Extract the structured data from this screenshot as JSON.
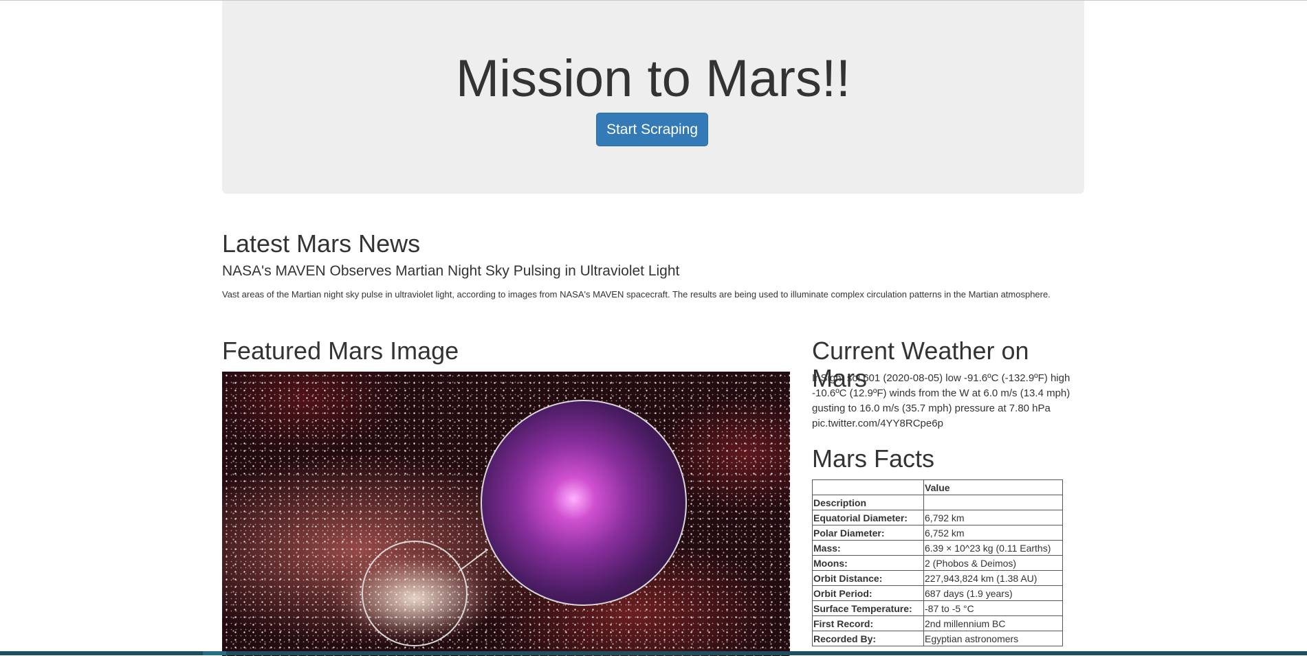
{
  "header": {
    "title": "Mission to Mars!!",
    "button_label": "Start Scraping"
  },
  "news": {
    "section_title": "Latest Mars News",
    "headline": "NASA's MAVEN Observes Martian Night Sky Pulsing in Ultraviolet Light",
    "teaser": "Vast areas of the Martian night sky pulse in ultraviolet light, according to images from NASA's MAVEN spacecraft. The results are being used to illuminate complex circulation patterns in the Martian atmosphere."
  },
  "featured_image": {
    "section_title": "Featured Mars Image"
  },
  "weather": {
    "section_title": "Current Weather on Mars",
    "text": "InSight sol 601 (2020-08-05) low -91.6ºC (-132.9ºF) high -10.6ºC (12.9ºF) winds from the W at 6.0 m/s (13.4 mph) gusting to 16.0 m/s (35.7 mph) pressure at 7.80 hPa pic.twitter.com/4YY8RCpe6p"
  },
  "facts": {
    "section_title": "Mars Facts",
    "header": [
      "",
      "Value"
    ],
    "index_label": "Description",
    "rows": [
      {
        "label": "Equatorial Diameter:",
        "value": "6,792 km"
      },
      {
        "label": "Polar Diameter:",
        "value": "6,752 km"
      },
      {
        "label": "Mass:",
        "value": "6.39 × 10^23 kg (0.11 Earths)"
      },
      {
        "label": "Moons:",
        "value": "2 (Phobos & Deimos)"
      },
      {
        "label": "Orbit Distance:",
        "value": "227,943,824 km (1.38 AU)"
      },
      {
        "label": "Orbit Period:",
        "value": "687 days (1.9 years)"
      },
      {
        "label": "Surface Temperature:",
        "value": "-87 to -5 °C"
      },
      {
        "label": "First Record:",
        "value": "2nd millennium BC"
      },
      {
        "label": "Recorded By:",
        "value": "Egyptian astronomers"
      }
    ]
  },
  "colors": {
    "button_bg": "#337ab7",
    "jumbotron_bg": "#eeeeee",
    "text": "#333333"
  }
}
